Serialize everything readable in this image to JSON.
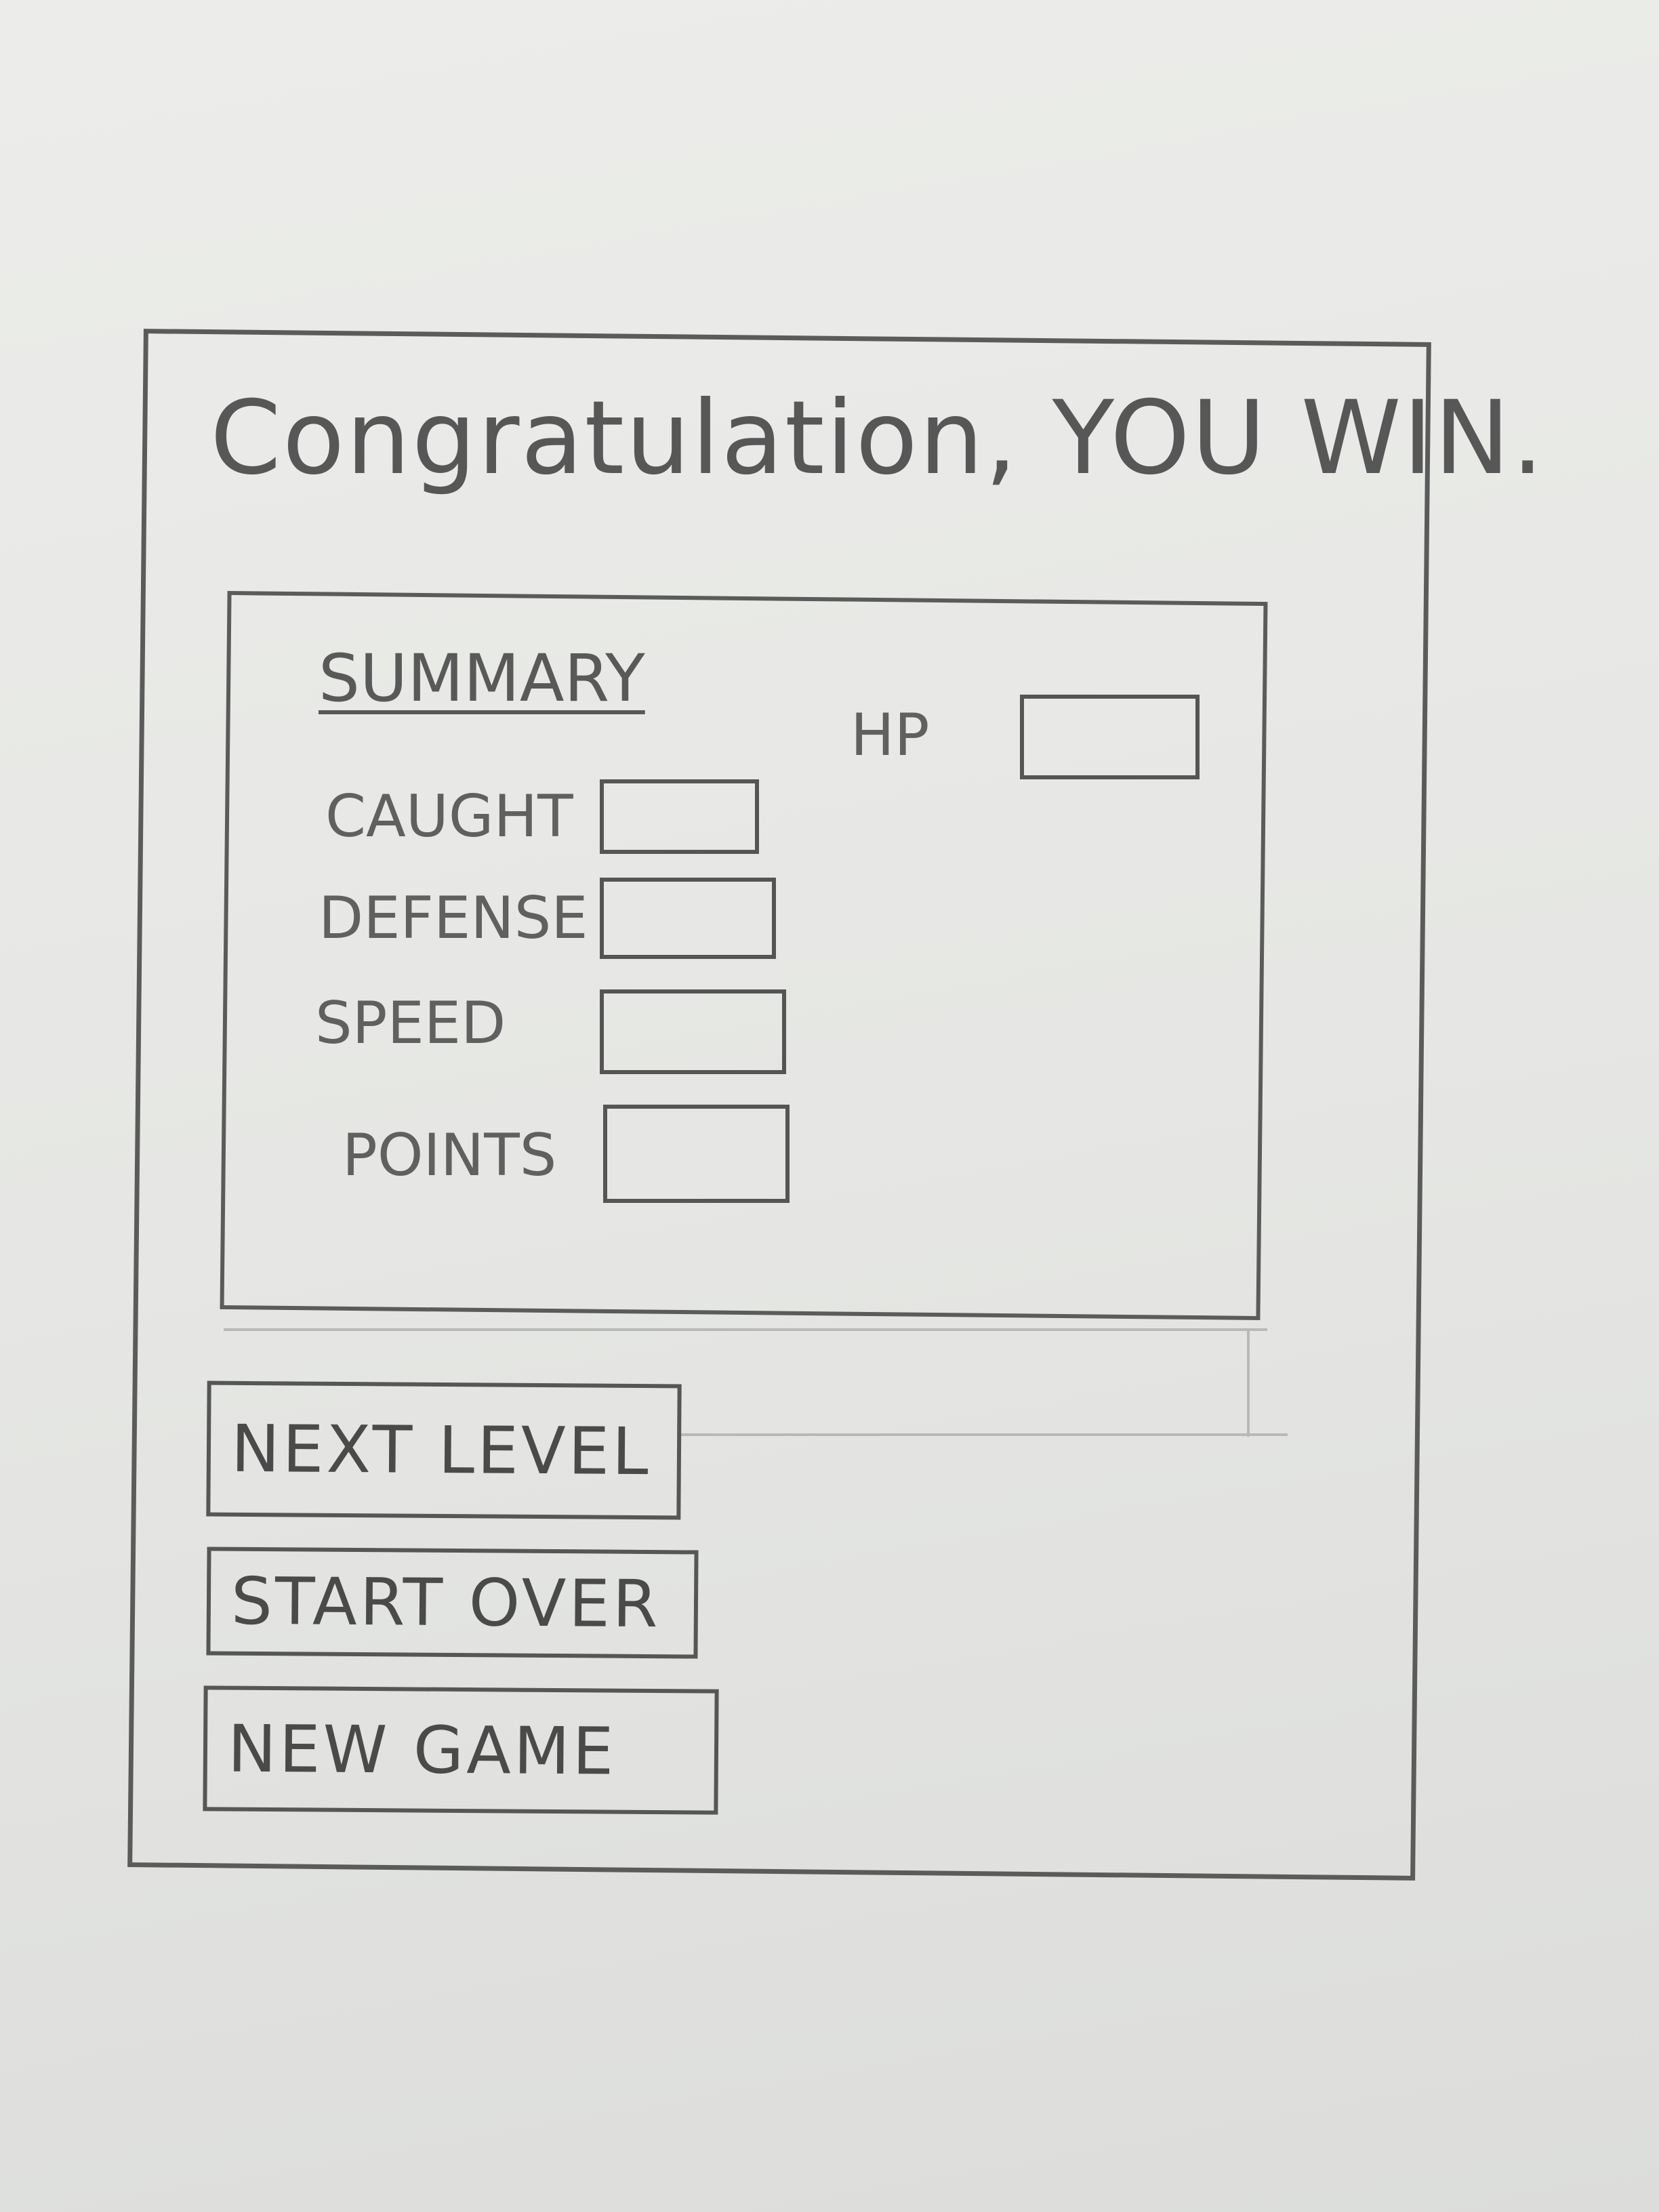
{
  "dialog": {
    "title": "Congratulation, YOU WIN."
  },
  "summary": {
    "heading": "SUMMARY",
    "fields": {
      "hp": {
        "label": "HP",
        "value": ""
      },
      "caught": {
        "label": "CAUGHT",
        "value": ""
      },
      "defense": {
        "label": "DEFENSE",
        "value": ""
      },
      "speed": {
        "label": "SPEED",
        "value": ""
      },
      "points": {
        "label": "POINTS",
        "value": ""
      }
    }
  },
  "actions": {
    "next_level": "NEXT LEVEL",
    "start_over": "START OVER",
    "new_game": "NEW GAME"
  }
}
